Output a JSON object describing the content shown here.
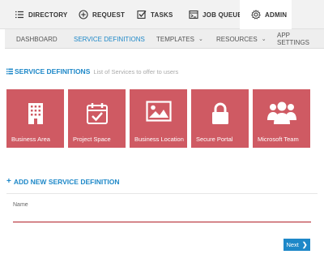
{
  "topnav": {
    "items": [
      {
        "label": "DIRECTORY",
        "icon": "list-icon"
      },
      {
        "label": "REQUEST",
        "icon": "plus-circle-icon"
      },
      {
        "label": "TASKS",
        "icon": "checkbox-icon"
      },
      {
        "label": "JOB QUEUE",
        "icon": "job-queue-icon"
      },
      {
        "label": "ADMIN",
        "icon": "gear-icon",
        "active": true
      }
    ]
  },
  "subnav": {
    "items": [
      {
        "label": "DASHBOARD"
      },
      {
        "label": "SERVICE DEFINITIONS",
        "active": true
      },
      {
        "label": "TEMPLATES",
        "dropdown": true
      },
      {
        "label": "RESOURCES",
        "dropdown": true
      },
      {
        "label": "APP SETTINGS"
      }
    ]
  },
  "section": {
    "title": "SERVICE DEFINITIONS",
    "subtitle": "List of Services to offer to users"
  },
  "tiles": [
    {
      "label": "Business Area",
      "icon": "building-icon"
    },
    {
      "label": "Project Space",
      "icon": "calendar-check-icon"
    },
    {
      "label": "Business Location",
      "icon": "image-icon"
    },
    {
      "label": "Secure Portal",
      "icon": "lock-icon"
    },
    {
      "label": "Microsoft Team",
      "icon": "team-icon"
    }
  ],
  "add_new": {
    "label": "ADD NEW SERVICE DEFINITION"
  },
  "form": {
    "name_label": "Name",
    "name_value": ""
  },
  "next_button": {
    "label": "Next"
  },
  "colors": {
    "accent": "#1e88c8",
    "tile": "#cf5a63",
    "input_underline": "#b01e26"
  }
}
